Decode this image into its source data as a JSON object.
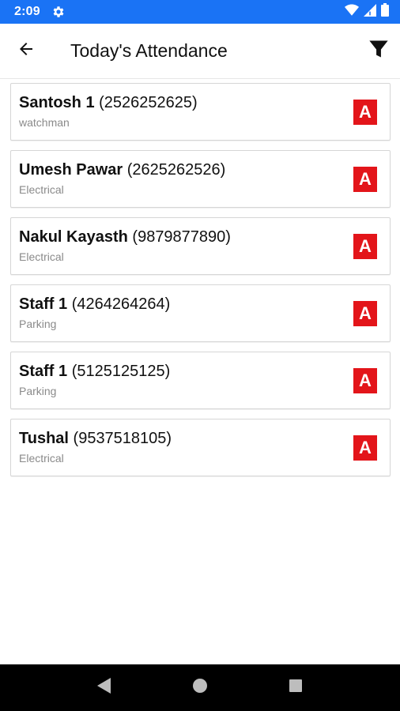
{
  "status_bar": {
    "time": "2:09"
  },
  "app_bar": {
    "title": "Today's Attendance"
  },
  "colors": {
    "status_bar": "#1a73f5",
    "badge": "#e3151a",
    "accent_text": "#111111"
  },
  "icons": [
    "settings-gear-icon",
    "wifi-icon",
    "signal-icon",
    "battery-icon",
    "back-arrow-icon",
    "filter-icon",
    "nav-back-icon",
    "nav-home-icon",
    "nav-recents-icon"
  ],
  "staff": [
    {
      "name": "Santosh 1",
      "phone": "(2526252625)",
      "role": "watchman",
      "status": "A"
    },
    {
      "name": "Umesh Pawar",
      "phone": "(2625262526)",
      "role": "Electrical",
      "status": "A"
    },
    {
      "name": "Nakul Kayasth",
      "phone": "(9879877890)",
      "role": "Electrical",
      "status": "A"
    },
    {
      "name": "Staff 1",
      "phone": "(4264264264)",
      "role": "Parking",
      "status": "A"
    },
    {
      "name": "Staff 1",
      "phone": "(5125125125)",
      "role": "Parking",
      "status": "A"
    },
    {
      "name": "Tushal",
      "phone": "(9537518105)",
      "role": "Electrical",
      "status": "A"
    }
  ]
}
